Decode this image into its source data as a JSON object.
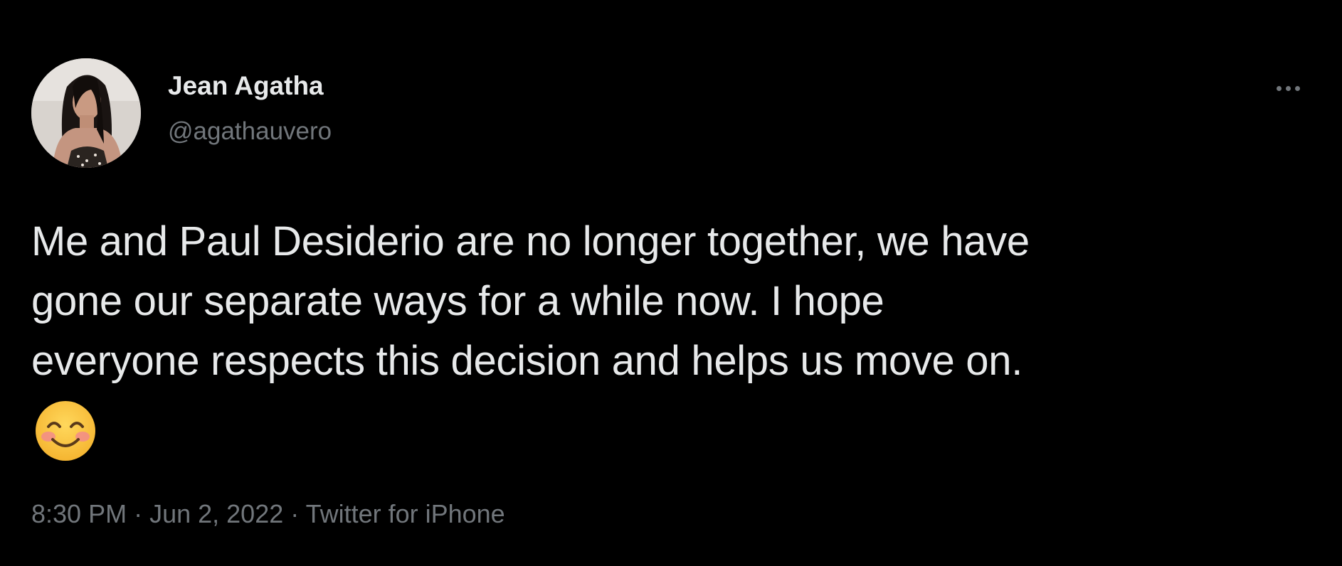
{
  "author": {
    "display_name": "Jean Agatha",
    "handle": "@agathauvero",
    "avatar_icon": "profile-photo"
  },
  "more_icon": "more-horizontal-icon",
  "tweet": {
    "text_lines": [
      "Me and Paul Desiderio are no longer together, we have",
      "gone our separate ways for a while now. I hope",
      "everyone respects this decision and helps us move on."
    ],
    "emoji": "smiling-face-with-smiling-eyes"
  },
  "meta": {
    "time": "8:30 PM",
    "separator": " · ",
    "date": "Jun 2, 2022",
    "source": "Twitter for iPhone"
  },
  "colors": {
    "background": "#000000",
    "primary_text": "#e7e9ea",
    "secondary_text": "#71767b"
  }
}
